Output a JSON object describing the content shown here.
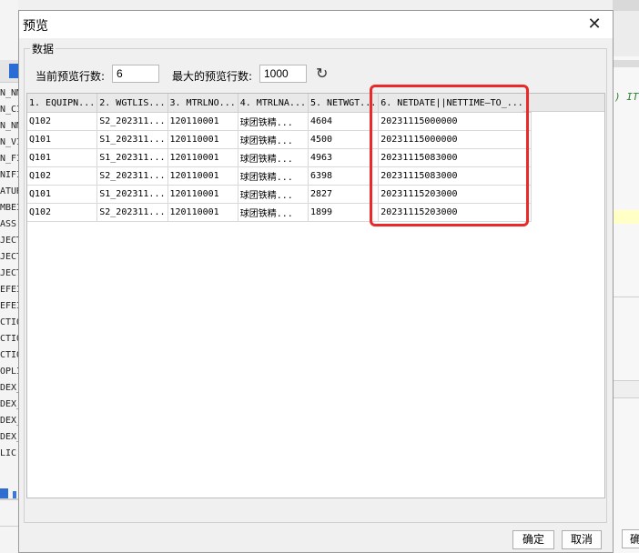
{
  "dialog": {
    "title": "预览",
    "close_glyph": "✕",
    "group_label": "数据",
    "current_rows_label": "当前预览行数:",
    "current_rows_value": "6",
    "max_rows_label": "最大的预览行数:",
    "max_rows_value": "1000",
    "refresh_glyph": "↻",
    "ok_label": "确定",
    "cancel_label": "取消"
  },
  "table": {
    "columns": [
      "1. EQUIPN...",
      "2. WGTLIS...",
      "3. MTRLNO...",
      "4. MTRLNA...",
      "5. NETWGT...",
      "6. NETDATE||NETTIME—TO_..."
    ],
    "rows": [
      [
        "Q102",
        "S2_202311...",
        "120110001",
        "球团铁精...",
        "4604",
        "20231115000000"
      ],
      [
        "Q101",
        "S1_202311...",
        "120110001",
        "球团铁精...",
        "4500",
        "20231115000000"
      ],
      [
        "Q101",
        "S1_202311...",
        "120110001",
        "球团铁精...",
        "4963",
        "20231115083000"
      ],
      [
        "Q102",
        "S2_202311...",
        "120110001",
        "球团铁精...",
        "6398",
        "20231115083000"
      ],
      [
        "Q101",
        "S1_202311...",
        "120110001",
        "球团铁精...",
        "2827",
        "20231115203000"
      ],
      [
        "Q102",
        "S2_202311...",
        "120110001",
        "球团铁精...",
        "1899",
        "20231115203000"
      ]
    ]
  },
  "background": {
    "left_items": [
      "N_NM",
      "N_CI",
      "N_NM",
      "N_VI",
      "N_FI",
      "NIFI",
      "ATUR",
      "MBEI",
      "ASS",
      "JECT",
      "JECT",
      "JECT",
      "EFEI",
      "EFEI",
      "CTIO",
      "CTIO",
      "CTIO",
      "OPLI",
      "DEX_",
      "DEX_",
      "DEX_",
      "DEX_",
      "LIC"
    ],
    "right_code": ") IT",
    "right_button": "确"
  },
  "colors": {
    "highlight": "#ea2a2a",
    "header_bg": "#e9e9e9",
    "accent_blue": "#2b6cd4"
  }
}
